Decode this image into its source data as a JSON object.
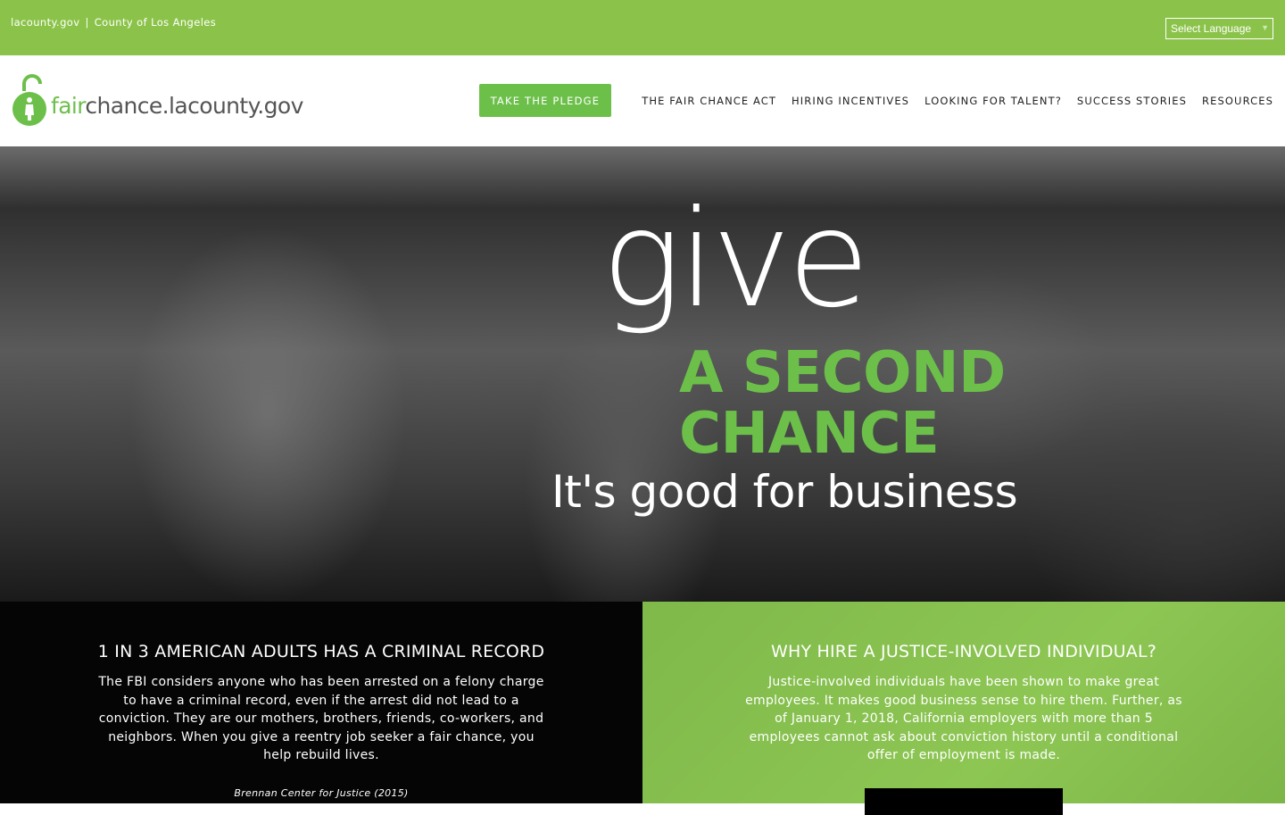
{
  "topbar": {
    "link1": "lacounty.gov",
    "separator": "|",
    "link2": "County of Los Angeles",
    "language_select": "Select Language"
  },
  "logo": {
    "part1": "fair",
    "part2": "chance.lacounty.gov",
    "icon": "padlock-person-icon"
  },
  "nav": {
    "pledge": "TAKE THE PLEDGE",
    "items": [
      "THE FAIR CHANCE ACT",
      "HIRING INCENTIVES",
      "LOOKING FOR TALENT?",
      "SUCCESS STORIES",
      "RESOURCES"
    ]
  },
  "hero": {
    "give": "give",
    "second_line1": "A SECOND",
    "second_line2": "CHANCE",
    "tagline": "It's good for business"
  },
  "panel_left": {
    "title": "1 IN 3 AMERICAN ADULTS HAS A CRIMINAL RECORD",
    "body": "The FBI considers anyone who has been arrested on a felony charge to have a criminal record, even if the arrest did not lead to a conviction. They are our mothers, brothers, friends, co-workers, and neighbors. When you give a reentry job seeker a fair chance, you help rebuild lives.",
    "citation": "Brennan Center for Justice (2015)"
  },
  "panel_right": {
    "title": "WHY HIRE A JUSTICE-INVOLVED INDIVIDUAL?",
    "body": "Justice-involved individuals have been shown to make great employees. It makes good business sense to hire them. Further, as of January 1, 2018, California employers with more than 5 employees cannot ask about conviction history until a conditional offer of employment is made."
  },
  "colors": {
    "brand_green": "#6cc04a",
    "topbar_green": "#8bc34a",
    "logo_gray": "#555555"
  }
}
